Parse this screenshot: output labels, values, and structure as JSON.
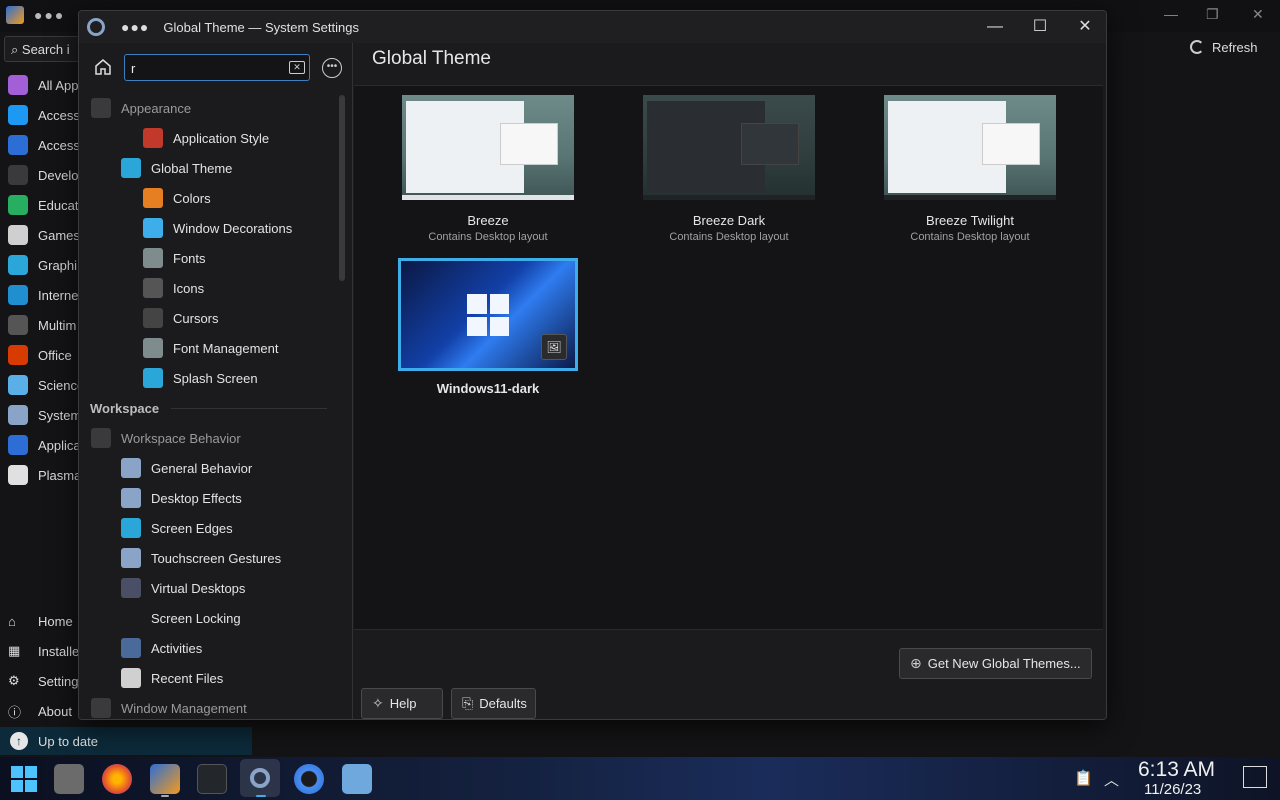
{
  "background_app": {
    "search_label": "Search i",
    "refresh_label": "Refresh",
    "categories": [
      {
        "label": "All App",
        "color": "#a35fd8"
      },
      {
        "label": "Access",
        "color": "#1d99f3"
      },
      {
        "label": "Access",
        "color": "#2d6ed6"
      },
      {
        "label": "Develo",
        "color": "#3a3a3a"
      },
      {
        "label": "Educat",
        "color": "#27ae60"
      },
      {
        "label": "Games",
        "color": "#cfcfcf"
      },
      {
        "label": "Graphi",
        "color": "#2aa6d8"
      },
      {
        "label": "Interne",
        "color": "#1f8fd0"
      },
      {
        "label": "Multim",
        "color": "#555555"
      },
      {
        "label": "Office",
        "color": "#d83b01"
      },
      {
        "label": "Science",
        "color": "#5ab0e6"
      },
      {
        "label": "System",
        "color": "#8aa4c8"
      },
      {
        "label": "Applica",
        "color": "#2d6ed6"
      },
      {
        "label": "Plasma",
        "color": "#e0e0e0"
      }
    ],
    "bottom_items": [
      {
        "label": "Home"
      },
      {
        "label": "Installe"
      },
      {
        "label": "Setting"
      },
      {
        "label": "About"
      }
    ],
    "status": "Up to date"
  },
  "window": {
    "title": "Global Theme — System Settings",
    "controls": {
      "minimize": "—",
      "maximize": "☐",
      "close": "✕"
    }
  },
  "sidebar": {
    "search_value": "r",
    "items": [
      {
        "label": "Appearance",
        "level": 0,
        "color": "#3a3a3d"
      },
      {
        "label": "Application Style",
        "level": 2,
        "color": "#c0392b"
      },
      {
        "label": "Global Theme",
        "level": 1,
        "color": "#2aa6d8"
      },
      {
        "label": "Colors",
        "level": 2,
        "color": "#e67e22"
      },
      {
        "label": "Window Decorations",
        "level": 2,
        "color": "#3daee9"
      },
      {
        "label": "Fonts",
        "level": 2,
        "color": "#7f8c8d"
      },
      {
        "label": "Icons",
        "level": 2,
        "color": "#555555"
      },
      {
        "label": "Cursors",
        "level": 2,
        "color": "#444444"
      },
      {
        "label": "Font Management",
        "level": 2,
        "color": "#7f8c8d"
      },
      {
        "label": "Splash Screen",
        "level": 2,
        "color": "#2aa6d8"
      }
    ],
    "section_workspace": "Workspace",
    "workspace_items": [
      {
        "label": "Workspace Behavior",
        "level": 0,
        "color": "#3a3a3d"
      },
      {
        "label": "General Behavior",
        "level": 1,
        "color": "#8aa4c8"
      },
      {
        "label": "Desktop Effects",
        "level": 1,
        "color": "#8aa4c8"
      },
      {
        "label": "Screen Edges",
        "level": 1,
        "color": "#2aa6d8"
      },
      {
        "label": "Touchscreen Gestures",
        "level": 1,
        "color": "#8aa4c8"
      },
      {
        "label": "Virtual Desktops",
        "level": 1,
        "color": "#4a4f66"
      },
      {
        "label": "Screen Locking",
        "level": 1,
        "color": "#1b1b1d"
      },
      {
        "label": "Activities",
        "level": 1,
        "color": "#4a6a9a"
      },
      {
        "label": "Recent Files",
        "level": 1,
        "color": "#d0d0d0"
      },
      {
        "label": "Window Management",
        "level": 0,
        "color": "#3a3a3d"
      }
    ]
  },
  "main": {
    "title": "Global Theme",
    "themes": [
      {
        "name": "Breeze",
        "subtitle": "Contains Desktop layout"
      },
      {
        "name": "Breeze Dark",
        "subtitle": "Contains Desktop layout"
      },
      {
        "name": "Breeze Twilight",
        "subtitle": "Contains Desktop layout"
      },
      {
        "name": "Windows11-dark",
        "subtitle": ""
      }
    ],
    "get_new_label": "Get New Global Themes...",
    "help_label": "Help",
    "defaults_label": "Defaults"
  },
  "taskbar": {
    "time": "6:13 AM",
    "date": "11/26/23"
  }
}
